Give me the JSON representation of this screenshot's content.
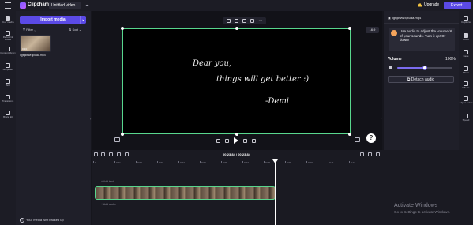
{
  "topbar": {
    "brand": "Clipchamp",
    "project_title": "Untitled video",
    "upgrade": "Upgrade",
    "export": "Export"
  },
  "left_rail": [
    {
      "label": "Your media",
      "icon": "folder-icon"
    },
    {
      "label": "Record & create",
      "icon": "camera-icon"
    },
    {
      "label": "Content library",
      "icon": "library-icon"
    },
    {
      "label": "Templates",
      "icon": "templates-icon"
    },
    {
      "label": "Text",
      "icon": "text-icon"
    },
    {
      "label": "Transitions",
      "icon": "transitions-icon"
    },
    {
      "label": "Brand kit",
      "icon": "brand-kit-icon"
    }
  ],
  "media": {
    "import_label": "Import media",
    "filter_label": "Filter",
    "sort_label": "Sort",
    "thumb_duration": "0:23",
    "thumb_name": "Ilgfqkwwr8jxuaa.mp4",
    "backup_notice": "Your media isn't backed up"
  },
  "preview": {
    "aspect_ratio": "16:9",
    "script_lines": [
      "Dear you,",
      "things will get better :)",
      "-Demi"
    ]
  },
  "properties": {
    "file_name": "Ilgfqkwwr8jxuaa.mp4",
    "tip": "Use audio to adjust the volume of your sounds. Turn it up! Or down!",
    "volume_label": "Volume",
    "volume_value": "100%",
    "volume_level": 0.5,
    "detach_audio": "Detach audio"
  },
  "right_rail": [
    {
      "label": "Captions",
      "icon": "captions-icon"
    },
    {
      "label": "Audio",
      "icon": "audio-icon"
    },
    {
      "label": "Fade",
      "icon": "fade-icon"
    },
    {
      "label": "Filters",
      "icon": "filters-icon"
    },
    {
      "label": "Effects",
      "icon": "effects-icon"
    },
    {
      "label": "Adjust colors",
      "icon": "adjust-colors-icon"
    },
    {
      "label": "Speed",
      "icon": "speed-icon"
    }
  ],
  "timeline": {
    "timecode": "00:23.84 / 00:23.84",
    "ticks": [
      "0",
      "0:01",
      "0:02",
      "0:03",
      "0:04",
      "0:05",
      "0:06",
      "0:07",
      "0:08",
      "0:09",
      "0:10",
      "0:11",
      "0:12"
    ],
    "add_text": "+ Add text",
    "add_audio": "+ Add audio"
  },
  "os_watermark": {
    "title": "Activate Windows",
    "subtitle": "Go to Settings to activate Windows."
  }
}
